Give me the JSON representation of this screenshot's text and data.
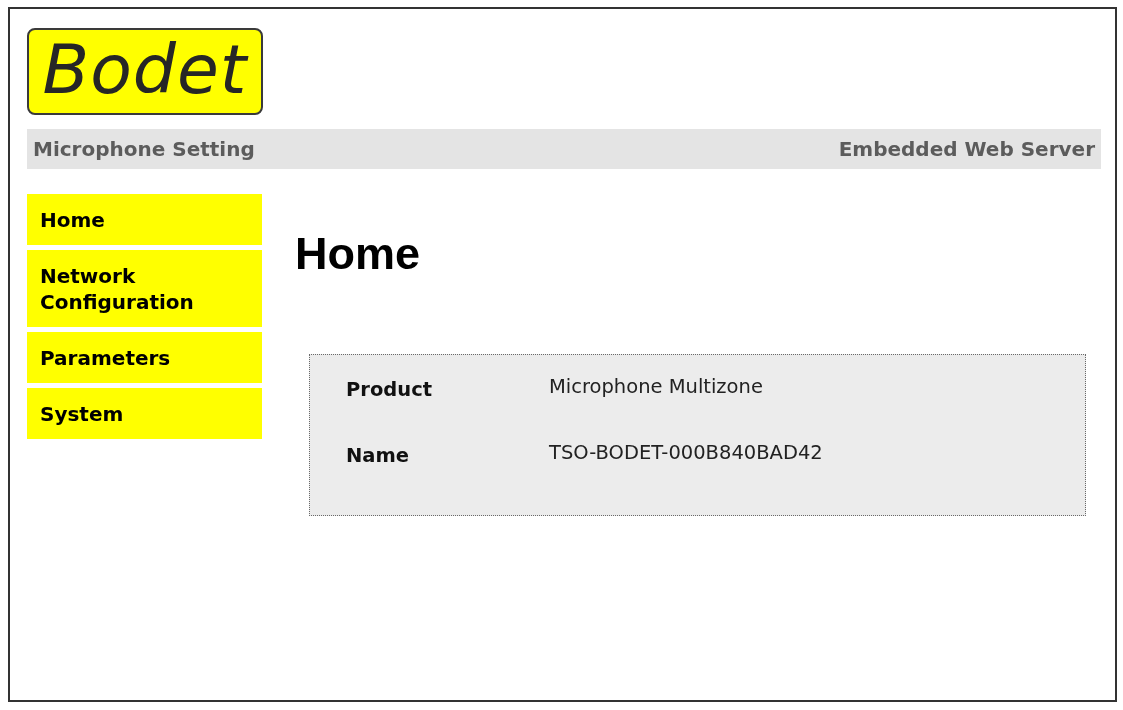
{
  "logo": {
    "text": "Bodet"
  },
  "header": {
    "title": "Microphone Setting",
    "subtitle": "Embedded Web Server"
  },
  "nav": [
    {
      "label": "Home"
    },
    {
      "label": "Network Configuration"
    },
    {
      "label": "Parameters"
    },
    {
      "label": "System"
    }
  ],
  "page": {
    "heading": "Home",
    "info": [
      {
        "label": "Product",
        "value": "Microphone Multizone"
      },
      {
        "label": "Name",
        "value": "TSO-BODET-000B840BAD42"
      }
    ]
  }
}
